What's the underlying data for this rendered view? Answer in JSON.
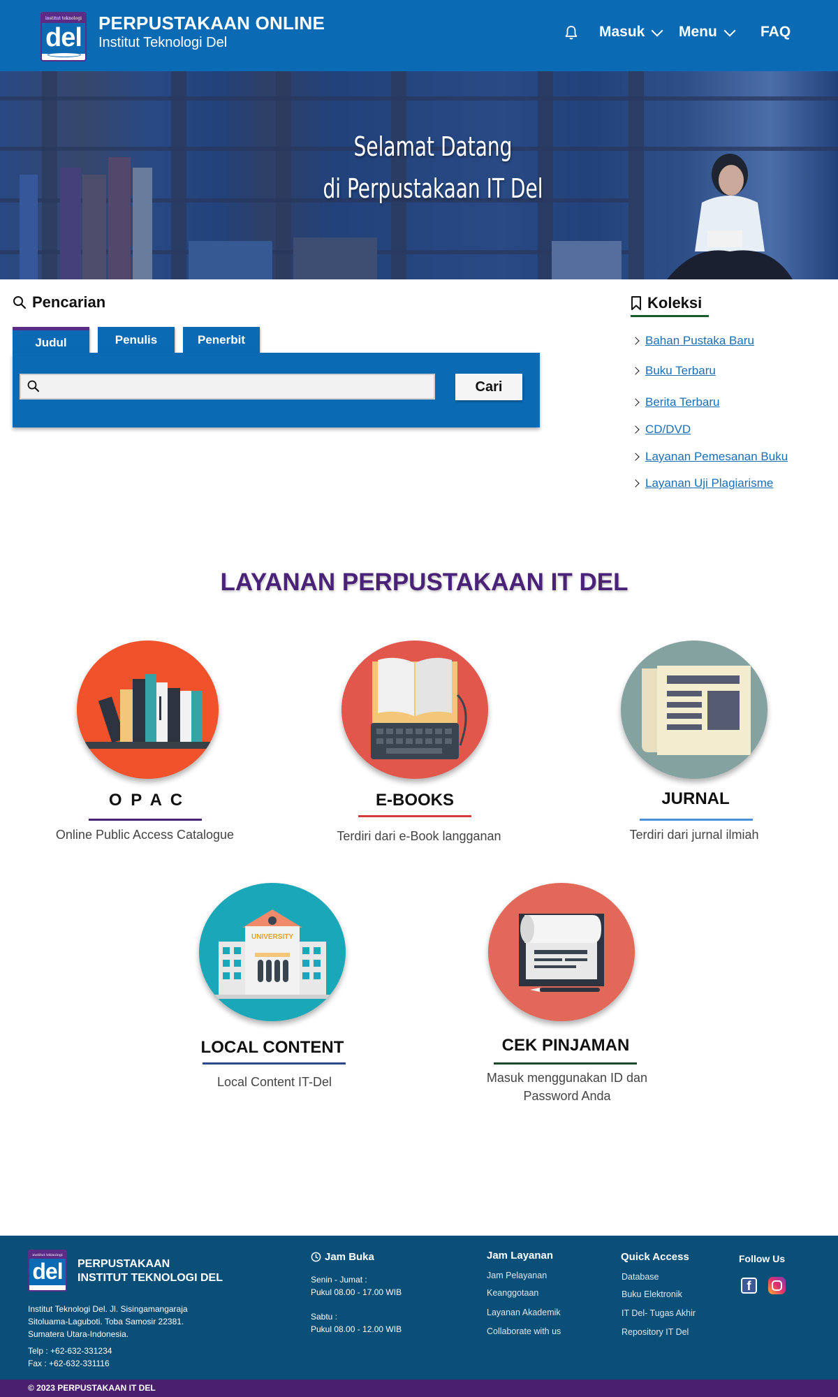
{
  "header": {
    "logo_small_text": "institut teknologi",
    "logo_text": "del",
    "title": "PERPUSTAKAAN ONLINE",
    "subtitle": "Institut Teknologi Del",
    "nav": [
      {
        "label": "Masuk"
      },
      {
        "label": "Menu"
      },
      {
        "label": "FAQ"
      }
    ]
  },
  "hero": {
    "line1": "Selamat Datang",
    "line2": "di Perpustakaan IT Del"
  },
  "search": {
    "title": "Pencarian",
    "tabs": [
      {
        "label": "Judul",
        "active": true
      },
      {
        "label": "Penulis",
        "active": false
      },
      {
        "label": "Penerbit",
        "active": false
      }
    ],
    "input_value": "",
    "input_placeholder": "",
    "button_label": "Cari"
  },
  "koleksi": {
    "title": "Koleksi",
    "items": [
      {
        "label": "Bahan Pustaka Baru"
      },
      {
        "label": "Buku Terbaru"
      },
      {
        "label": "Berita Terbaru"
      },
      {
        "label": "CD/DVD"
      },
      {
        "label": "Layanan Pemesanan Buku"
      },
      {
        "label": "Layanan Uji Plagiarisme"
      }
    ]
  },
  "layanan": {
    "title": "LAYANAN PERPUSTAKAAN IT DEL",
    "services": [
      {
        "name": "O P A C",
        "desc": "Online Public Access Catalogue",
        "color": "#f0532b",
        "line_color": "#4a2378"
      },
      {
        "name": "E-BOOKS",
        "desc": "Terdiri dari e-Book langganan",
        "color": "#e2574c",
        "line_color": "#d63b3b"
      },
      {
        "name": "JURNAL",
        "desc": "Terdiri dari jurnal ilmiah",
        "color": "#84a3a0",
        "line_color": "#4a90d9"
      },
      {
        "name": "LOCAL CONTENT",
        "desc": "Local Content IT-Del",
        "color": "#1aa8b8",
        "line_color": "#2a4a8a",
        "building_label": "UNIVERSITY"
      },
      {
        "name": "CEK PINJAMAN",
        "desc_line1": "Masuk menggunakan ID dan",
        "desc_line2": "Password Anda",
        "color": "#e2685a",
        "line_color": "#1b4a2a"
      }
    ]
  },
  "footer": {
    "logo_small_text": "institut teknologi",
    "logo_text": "del",
    "title_line1": "PERPUSTAKAAN",
    "title_line2": "INSTITUT TEKNOLOGI DEL",
    "address_line1": "Institut Teknologi Del. Jl. Sisingamangaraja",
    "address_line2": "Sitoluama-Laguboti. Toba Samosir 22381.",
    "address_line3": "Sumatera Utara-Indonesia.",
    "telp": "Telp : +62-632-331234",
    "fax": "Fax : +62-632-331116",
    "jam_buka": {
      "title": "Jam Buka",
      "weekday_label": "Senin - Jumat :",
      "weekday_hours": "Pukul 08.00 - 17.00 WIB",
      "saturday_label": "Sabtu :",
      "saturday_hours": "Pukul 08.00 - 12.00 WIB"
    },
    "jam_layanan": {
      "title": "Jam Layanan",
      "links": [
        "Jam Pelayanan",
        "Keanggotaan",
        "Layanan Akademik",
        "Collaborate with us"
      ]
    },
    "quick_access": {
      "title": "Quick Access",
      "links": [
        "Database",
        "Buku Elektronik",
        "IT Del- Tugas Akhir",
        "Repository IT Del"
      ]
    },
    "follow_us": {
      "title": "Follow Us",
      "facebook_letter": "f"
    }
  },
  "copyright": "© 2023 PERPUSTAKAAN IT DEL",
  "colors": {
    "primary": "#0a6ab3",
    "purple": "#4a2378",
    "footer": "#0a4f78"
  }
}
